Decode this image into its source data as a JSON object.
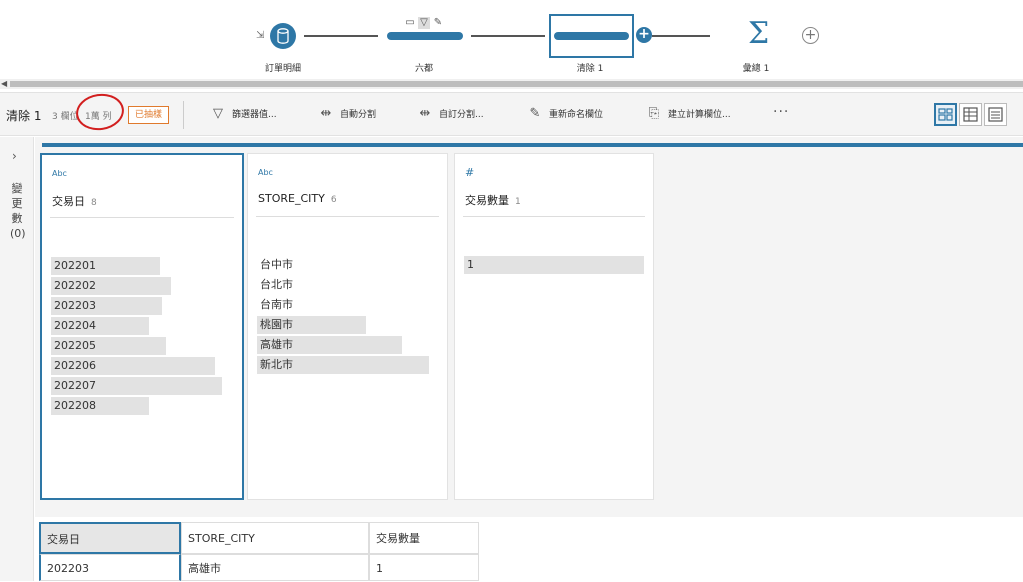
{
  "flow": {
    "nodes": [
      {
        "label": "訂單明細",
        "icon": "database-icon"
      },
      {
        "label": "六都",
        "icon": "filter-step-icon"
      },
      {
        "label": "清除 1",
        "icon": "clean-step-icon"
      },
      {
        "label": "彙總 1",
        "icon": "sigma-icon"
      }
    ],
    "add_icon": "plus-circle-icon"
  },
  "toolbar": {
    "step_name": "清除 1",
    "fields_count": "3 欄位",
    "rows_count": "1萬 列",
    "sampled_badge": "已抽樣",
    "buttons": [
      {
        "label": "篩選器值...",
        "icon": "filter-icon"
      },
      {
        "label": "自動分割",
        "icon": "split-icon"
      },
      {
        "label": "自訂分割...",
        "icon": "custom-split-icon"
      },
      {
        "label": "重新命名欄位",
        "icon": "rename-icon"
      },
      {
        "label": "建立計算欄位...",
        "icon": "calc-field-icon"
      }
    ],
    "more_label": "···",
    "view_modes": [
      "profile-view-icon",
      "data-grid-view-icon",
      "list-view-icon"
    ]
  },
  "rail": {
    "chevron": "›",
    "label": "變更數 (0)"
  },
  "profile": {
    "cards": [
      {
        "type": "Abc",
        "name": "交易日",
        "count": "8",
        "values": [
          {
            "label": "202201",
            "frac": 0.6
          },
          {
            "label": "202202",
            "frac": 0.66
          },
          {
            "label": "202203",
            "frac": 0.61
          },
          {
            "label": "202204",
            "frac": 0.54
          },
          {
            "label": "202205",
            "frac": 0.63
          },
          {
            "label": "202206",
            "frac": 0.9
          },
          {
            "label": "202207",
            "frac": 0.94
          },
          {
            "label": "202208",
            "frac": 0.54
          }
        ]
      },
      {
        "type": "Abc",
        "name": "STORE_CITY",
        "count": "6",
        "values": [
          {
            "label": "台中市",
            "frac": 0.0
          },
          {
            "label": "台北市",
            "frac": 0.0
          },
          {
            "label": "台南市",
            "frac": 0.0
          },
          {
            "label": "桃園市",
            "frac": 0.6
          },
          {
            "label": "高雄市",
            "frac": 0.8
          },
          {
            "label": "新北市",
            "frac": 0.95
          }
        ]
      },
      {
        "type": "#",
        "name": "交易數量",
        "count": "1",
        "values": [
          {
            "label": "1",
            "frac": 1.0
          }
        ]
      }
    ]
  },
  "grid": {
    "headers": [
      "交易日",
      "STORE_CITY",
      "交易數量"
    ],
    "rows": [
      [
        "202203",
        "高雄市",
        "1"
      ]
    ]
  }
}
